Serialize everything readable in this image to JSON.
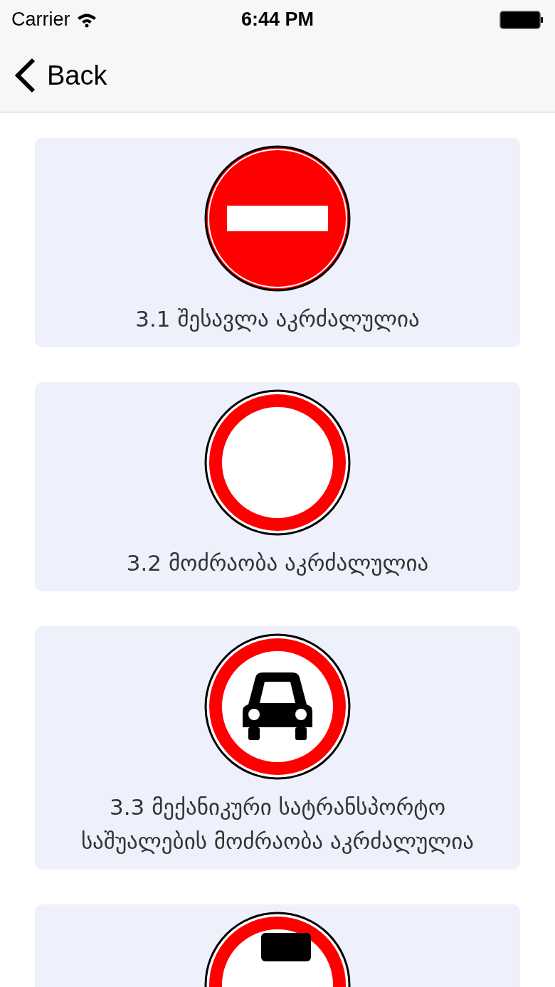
{
  "status_bar": {
    "carrier": "Carrier",
    "time": "6:44 PM"
  },
  "nav": {
    "back": "Back"
  },
  "signs": [
    {
      "kind": "no_entry",
      "title": "3.1 შესავლა აკრძალულია"
    },
    {
      "kind": "no_traffic",
      "title": "3.2 მოძრაობა აკრძალულია"
    },
    {
      "kind": "no_cars",
      "title": "3.3 მექანიკური სატრანსპორტო საშუალების მოძრაობა აკრძალულია"
    },
    {
      "kind": "black_top"
    }
  ]
}
